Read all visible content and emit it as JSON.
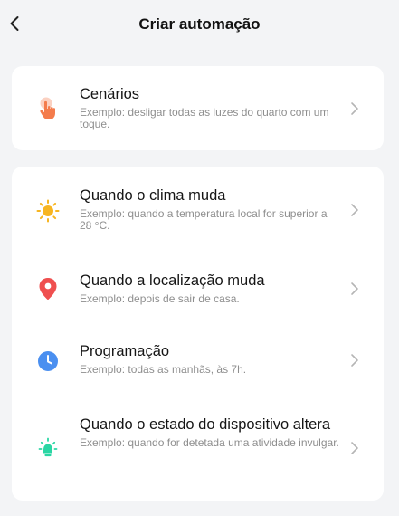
{
  "header": {
    "title": "Criar automação"
  },
  "scenes_card": {
    "items": [
      {
        "icon": "tap-hand-icon",
        "title": "Cenários",
        "subtitle": "Exemplo: desligar todas as luzes do quarto com um toque.",
        "color": "#f47c4c"
      }
    ]
  },
  "triggers_card": {
    "items": [
      {
        "icon": "sun-icon",
        "title": "Quando o clima muda",
        "subtitle": "Exemplo: quando a temperatura local for superior a 28 °C.",
        "color": "#f7b521"
      },
      {
        "icon": "location-pin-icon",
        "title": "Quando a localização muda",
        "subtitle": "Exemplo: depois de sair de casa.",
        "color": "#ef4f4f"
      },
      {
        "icon": "clock-icon",
        "title": "Programação",
        "subtitle": "Exemplo: todas as manhãs, às 7h.",
        "color": "#4a8ff0"
      },
      {
        "icon": "device-status-icon",
        "title": "Quando o estado do dispositivo altera",
        "subtitle": "Exemplo: quando for detetada uma atividade invulgar.",
        "color": "#2bd6a4"
      }
    ]
  }
}
